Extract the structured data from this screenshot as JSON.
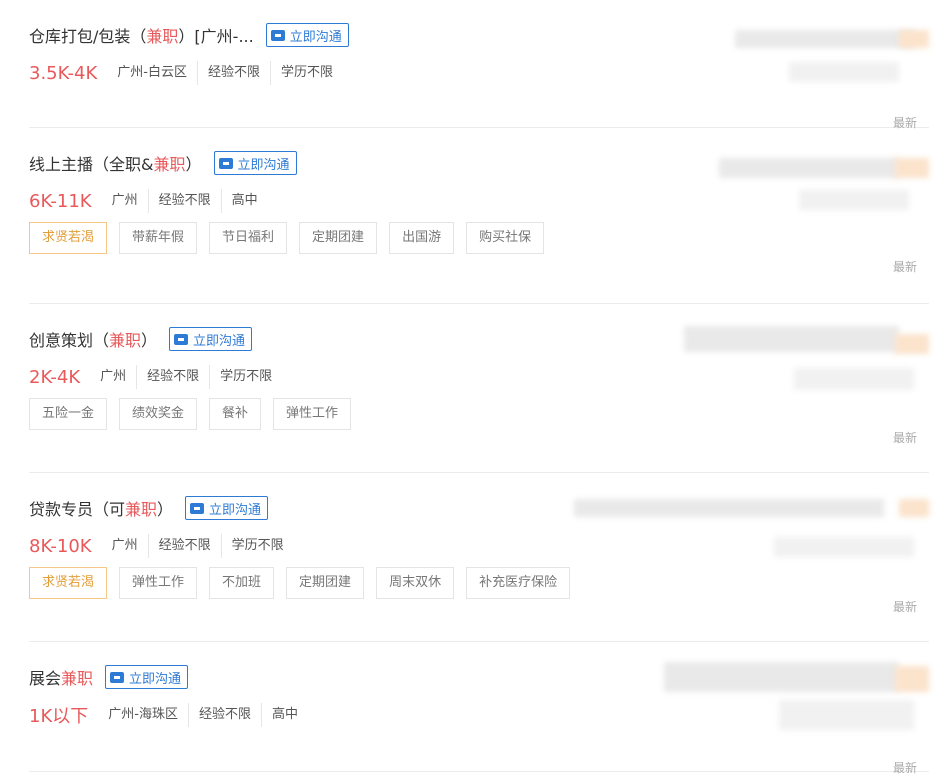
{
  "chat_label": "立即沟通",
  "newest_label": "最新",
  "jobs": [
    {
      "title_parts": [
        "仓库打包/包装（",
        "兼职",
        "）[广州-..."
      ],
      "salary": "3.5K-4K",
      "infos": [
        "广州-白云区",
        "经验不限",
        "学历不限"
      ],
      "tags": []
    },
    {
      "title_parts": [
        "线上主播（全职&",
        "兼职",
        "）"
      ],
      "salary": "6K-11K",
      "infos": [
        "广州",
        "经验不限",
        "高中"
      ],
      "tags": [
        "求贤若渴",
        "带薪年假",
        "节日福利",
        "定期团建",
        "出国游",
        "购买社保"
      ]
    },
    {
      "title_parts": [
        "创意策划（",
        "兼职",
        "）"
      ],
      "salary": "2K-4K",
      "infos": [
        "广州",
        "经验不限",
        "学历不限"
      ],
      "tags": [
        "五险一金",
        "绩效奖金",
        "餐补",
        "弹性工作"
      ]
    },
    {
      "title_parts": [
        "贷款专员（可",
        "兼职",
        "）"
      ],
      "salary": "8K-10K",
      "infos": [
        "广州",
        "经验不限",
        "学历不限"
      ],
      "tags": [
        "求贤若渴",
        "弹性工作",
        "不加班",
        "定期团建",
        "周末双休",
        "补充医疗保险"
      ]
    },
    {
      "title_parts": [
        "展会",
        "兼职",
        ""
      ],
      "salary": "1K以下",
      "infos": [
        "广州-海珠区",
        "经验不限",
        "高中"
      ],
      "tags": []
    }
  ]
}
